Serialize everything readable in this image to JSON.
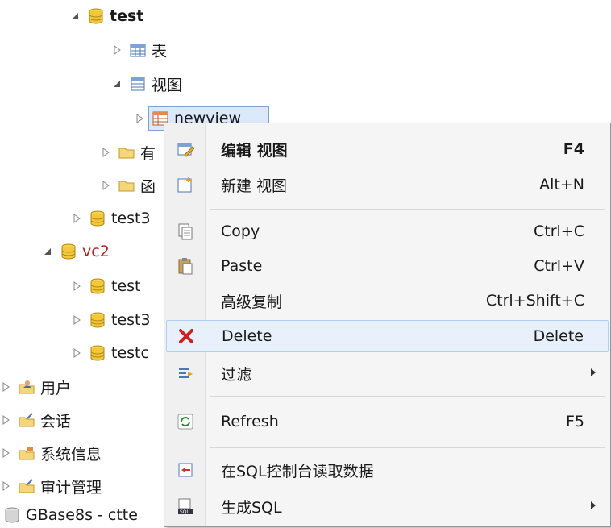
{
  "tree": [
    {
      "label": "test",
      "bold": true
    },
    {
      "label": "表"
    },
    {
      "label": "视图"
    },
    {
      "label": "newview"
    },
    {
      "label": "有"
    },
    {
      "label": "函"
    },
    {
      "label": "test3"
    },
    {
      "label": "vc2"
    },
    {
      "label": "test"
    },
    {
      "label": "test3"
    },
    {
      "label": "testc"
    },
    {
      "label": "用户"
    },
    {
      "label": "会话"
    },
    {
      "label": "系统信息"
    },
    {
      "label": "审计管理"
    },
    {
      "label": "GBase8s - ctte"
    }
  ],
  "menu": {
    "items": [
      {
        "label": "编辑 视图",
        "shortcut": "F4",
        "icon": "edit-view-icon"
      },
      {
        "label": "新建 视图",
        "shortcut": "Alt+N",
        "icon": "new-view-icon"
      },
      {
        "label": "Copy",
        "shortcut": "Ctrl+C",
        "icon": "copy-icon"
      },
      {
        "label": "Paste",
        "shortcut": "Ctrl+V",
        "icon": "paste-icon"
      },
      {
        "label": "高级复制",
        "shortcut": "Ctrl+Shift+C",
        "icon": ""
      },
      {
        "label": "Delete",
        "shortcut": "Delete",
        "icon": "delete-icon"
      },
      {
        "label": "过滤",
        "shortcut": "",
        "icon": "filter-icon"
      },
      {
        "label": "Refresh",
        "shortcut": "F5",
        "icon": "refresh-icon"
      },
      {
        "label": "在SQL控制台读取数据",
        "shortcut": "",
        "icon": "sql-console-icon"
      },
      {
        "label": "生成SQL",
        "shortcut": "",
        "icon": "generate-sql-icon"
      }
    ]
  }
}
